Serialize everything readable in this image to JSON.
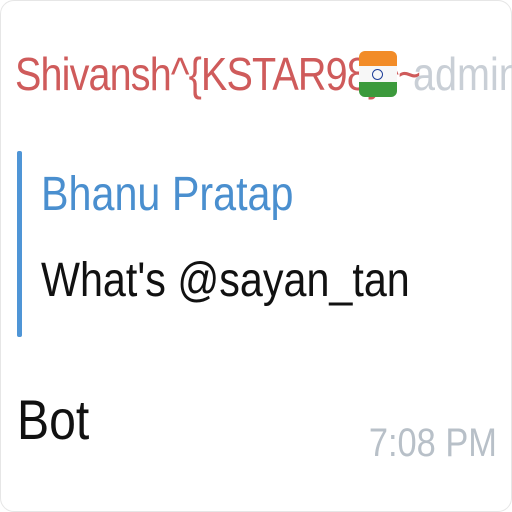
{
  "header": {
    "sender_name": "Shivansh^{KSTAR98}^~",
    "flag_icon": "india-flag-icon",
    "role": "admin"
  },
  "reply": {
    "author": "Bhanu Pratap",
    "text": "What's @sayan_tan"
  },
  "message": {
    "text": "Bot",
    "time": "7:08 PM"
  },
  "colors": {
    "sender": "#cf5b5b",
    "role": "#c9cfd6",
    "reply_bar": "#4f95d6",
    "reply_author": "#4a8fcf",
    "time": "#b8c0c8"
  }
}
